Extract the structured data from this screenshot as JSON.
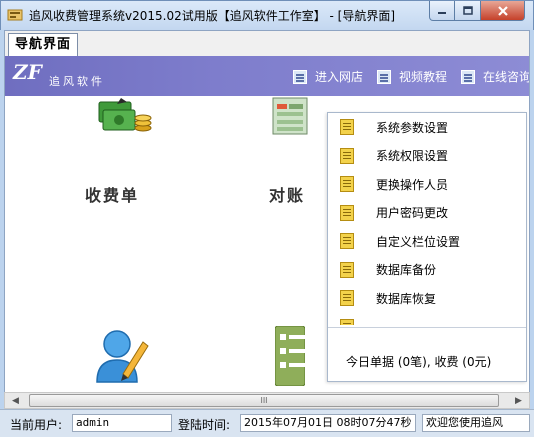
{
  "window": {
    "title": "追风收费管理系统v2015.02试用版【追风软件工作室】 - [导航界面]",
    "controls": {
      "minimize": "minimize-icon",
      "maximize": "maximize-icon",
      "close": "close-icon"
    }
  },
  "tab": {
    "label": "导航界面"
  },
  "banner": {
    "logo_mark": "ZF",
    "logo_text": "追风软件",
    "links": [
      {
        "label": "进入网店"
      },
      {
        "label": "视频教程"
      },
      {
        "label": "在线咨询"
      }
    ]
  },
  "modules": [
    {
      "label": "收费单",
      "icon": "money-icon"
    },
    {
      "label": "对账",
      "icon": "report-icon"
    },
    {
      "label": "",
      "icon": "user-edit-icon"
    },
    {
      "label": "",
      "icon": "list-icon"
    }
  ],
  "popup": {
    "items": [
      {
        "label": "系统参数设置"
      },
      {
        "label": "系统权限设置"
      },
      {
        "label": "更换操作人员"
      },
      {
        "label": "用户密码更改"
      },
      {
        "label": "自定义栏位设置"
      },
      {
        "label": "数据库备份"
      },
      {
        "label": "数据库恢复"
      },
      {
        "label": ""
      }
    ],
    "status": "今日单据 (0笔), 收费 (0元)"
  },
  "scrollbar": {
    "thumb_grip": "III"
  },
  "statusbar": {
    "user_label": "当前用户:",
    "user_value": "admin",
    "login_label": "登陆时间:",
    "login_value": "2015年07月01日 08时07分47秒",
    "welcome": "欢迎您使用追风"
  },
  "colors": {
    "banner": "#7e7dcc",
    "close_button": "#c5412a",
    "status_bar": "#d9e4f1"
  }
}
